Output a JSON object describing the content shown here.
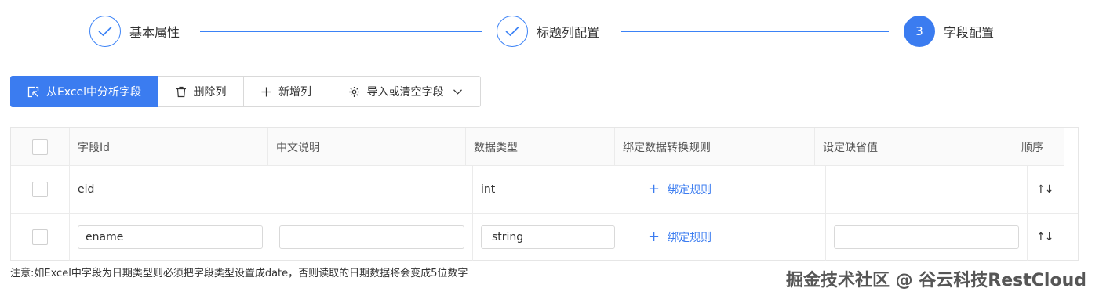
{
  "steps": [
    {
      "title": "基本属性",
      "state": "done",
      "icon": "check-icon"
    },
    {
      "title": "标题列配置",
      "state": "done",
      "icon": "check-icon"
    },
    {
      "title": "字段配置",
      "state": "active",
      "number": "3"
    }
  ],
  "toolbar": {
    "analyze_label": "从Excel中分析字段",
    "delete_label": "删除列",
    "add_label": "新增列",
    "import_label": "导入或清空字段"
  },
  "table": {
    "headers": {
      "field_id": "字段Id",
      "cn_desc": "中文说明",
      "data_type": "数据类型",
      "bind_rule": "绑定数据转换规则",
      "default_value": "设定缺省值",
      "order": "顺序"
    },
    "rows": [
      {
        "field_id": "eid",
        "cn_desc": "",
        "data_type": "int",
        "bind_rule": "绑定规则",
        "default_value": "",
        "order": "↑↓"
      },
      {
        "field_id": "ename",
        "cn_desc": "",
        "data_type": "string",
        "bind_rule": "绑定规则",
        "default_value": "",
        "order": "↑↓"
      }
    ]
  },
  "note": "注意:如Excel中字段为日期类型则必须把字段类型设置成date，否则读取的日期数据将会变成5位数字",
  "watermark": "掘金技术社区 @ 谷云科技RestCloud",
  "colors": {
    "primary": "#3b7cf0"
  }
}
